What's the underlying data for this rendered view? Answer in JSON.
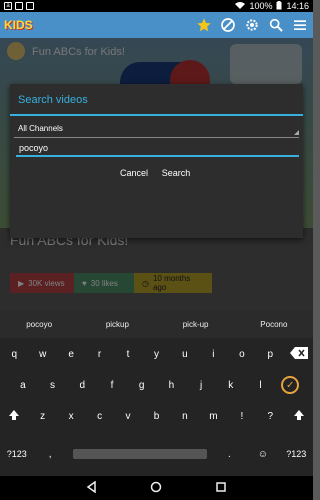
{
  "status_bar": {
    "battery": "100%",
    "time": "14:16",
    "left_icons": [
      "amazon-icon",
      "app-icon",
      "app-icon"
    ]
  },
  "app_bar": {
    "logo": "KIDS",
    "icons": [
      "star-icon",
      "block-icon",
      "gear-icon",
      "search-icon",
      "menu-icon"
    ]
  },
  "background": {
    "video_title": "Fun ABCs for Kids!",
    "heading": "Fun ABCs for Kids!",
    "views": "30K views",
    "likes": "30 likes",
    "ago": "10 months ago"
  },
  "dialog": {
    "title": "Search videos",
    "channel_selected": "All Channels",
    "search_value": "pocoyo",
    "cancel_label": "Cancel",
    "search_label": "Search",
    "accent": "#38b0de"
  },
  "keyboard": {
    "suggestions": [
      "pocoyo",
      "pickup",
      "pick-up",
      "Pocono"
    ],
    "row1": [
      "q",
      "w",
      "e",
      "r",
      "t",
      "y",
      "u",
      "i",
      "o",
      "p"
    ],
    "row2": [
      "a",
      "s",
      "d",
      "f",
      "g",
      "h",
      "j",
      "k",
      "l"
    ],
    "row3": [
      "z",
      "x",
      "c",
      "v",
      "b",
      "n",
      "m",
      "!",
      "?"
    ],
    "row4_left": "?123",
    "row4_comma": ",",
    "row4_period": ".",
    "row4_emoji": "☺",
    "row4_right": "?123"
  }
}
